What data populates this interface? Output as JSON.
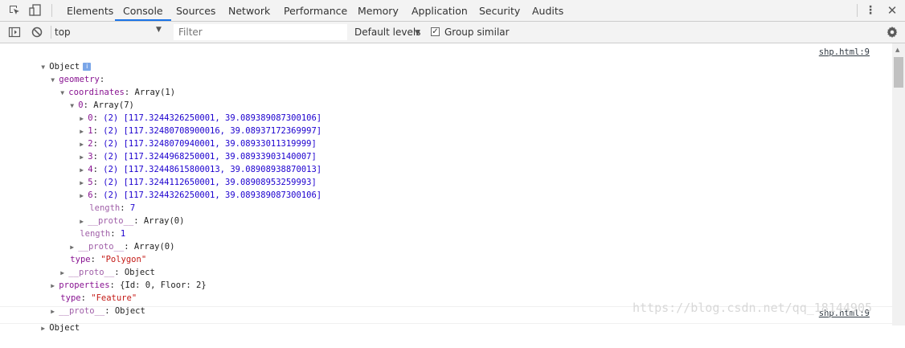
{
  "tabs": [
    "Elements",
    "Console",
    "Sources",
    "Network",
    "Performance",
    "Memory",
    "Application",
    "Security",
    "Audits"
  ],
  "active_tab": "Console",
  "toolbar": {
    "context": "top",
    "filter_placeholder": "Filter",
    "levels": "Default levels",
    "group_similar": "Group similar",
    "group_similar_checked": true
  },
  "messages": [
    {
      "source": "shp.html:9",
      "lines": {
        "root": "Object",
        "geometry": "geometry",
        "coordinates_key": "coordinates",
        "coordinates_val": "Array(1)",
        "idx0_key": "0",
        "idx0_val": "Array(7)",
        "items": [
          {
            "key": "0",
            "val": "(2) [117.3244326250001, 39.089389087300106]"
          },
          {
            "key": "1",
            "val": "(2) [117.32480708900016, 39.08937172369997]"
          },
          {
            "key": "2",
            "val": "(2) [117.3248070940001, 39.08933011319999]"
          },
          {
            "key": "3",
            "val": "(2) [117.3244968250001, 39.08933903140007]"
          },
          {
            "key": "4",
            "val": "(2) [117.32448615800013, 39.08908938870013]"
          },
          {
            "key": "5",
            "val": "(2) [117.3244112650001, 39.08908953259993]"
          },
          {
            "key": "6",
            "val": "(2) [117.3244326250001, 39.089389087300106]"
          }
        ],
        "length_inner_key": "length",
        "length_inner_val": "7",
        "proto_inner_key": "__proto__",
        "proto_inner_val": "Array(0)",
        "length_outer_key": "length",
        "length_outer_val": "1",
        "proto_outer_key": "__proto__",
        "proto_outer_val": "Array(0)",
        "type_key": "type",
        "type_val": "\"Polygon\"",
        "proto_geom_key": "__proto__",
        "proto_geom_val": "Object",
        "properties_key": "properties",
        "properties_val": "{Id: 0, Floor: 2}",
        "feature_type_key": "type",
        "feature_type_val": "\"Feature\"",
        "proto_root_key": "__proto__",
        "proto_root_val": "Object"
      }
    },
    {
      "source": "shp.html:9",
      "root": "Object"
    }
  ],
  "watermark": "https://blog.csdn.net/qq_18144905"
}
